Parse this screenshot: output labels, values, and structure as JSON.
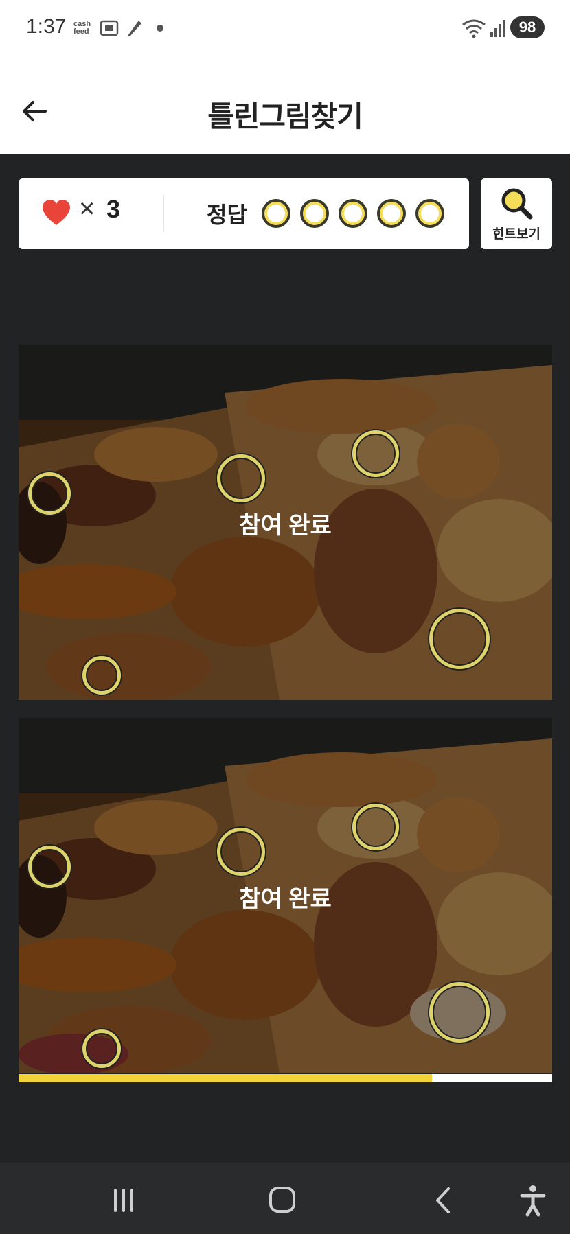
{
  "status_bar": {
    "time": "1:37",
    "cash_feed": "cash feed",
    "battery": "98"
  },
  "header": {
    "title": "틀린그림찾기"
  },
  "game": {
    "lives_symbol": "×",
    "lives": "3",
    "answer_label": "정답",
    "answer_slots": 5,
    "hint_label": "힌트보기",
    "done_label": "참여 완료",
    "progress": 0.775
  },
  "colors": {
    "accent_yellow": "#f2d43a",
    "heart_red": "#e8443a",
    "background": "#222325"
  },
  "icons": [
    "back-arrow-icon",
    "heart-icon",
    "magnifier-icon",
    "recent-apps-icon",
    "home-icon",
    "nav-back-icon",
    "accessibility-icon"
  ]
}
